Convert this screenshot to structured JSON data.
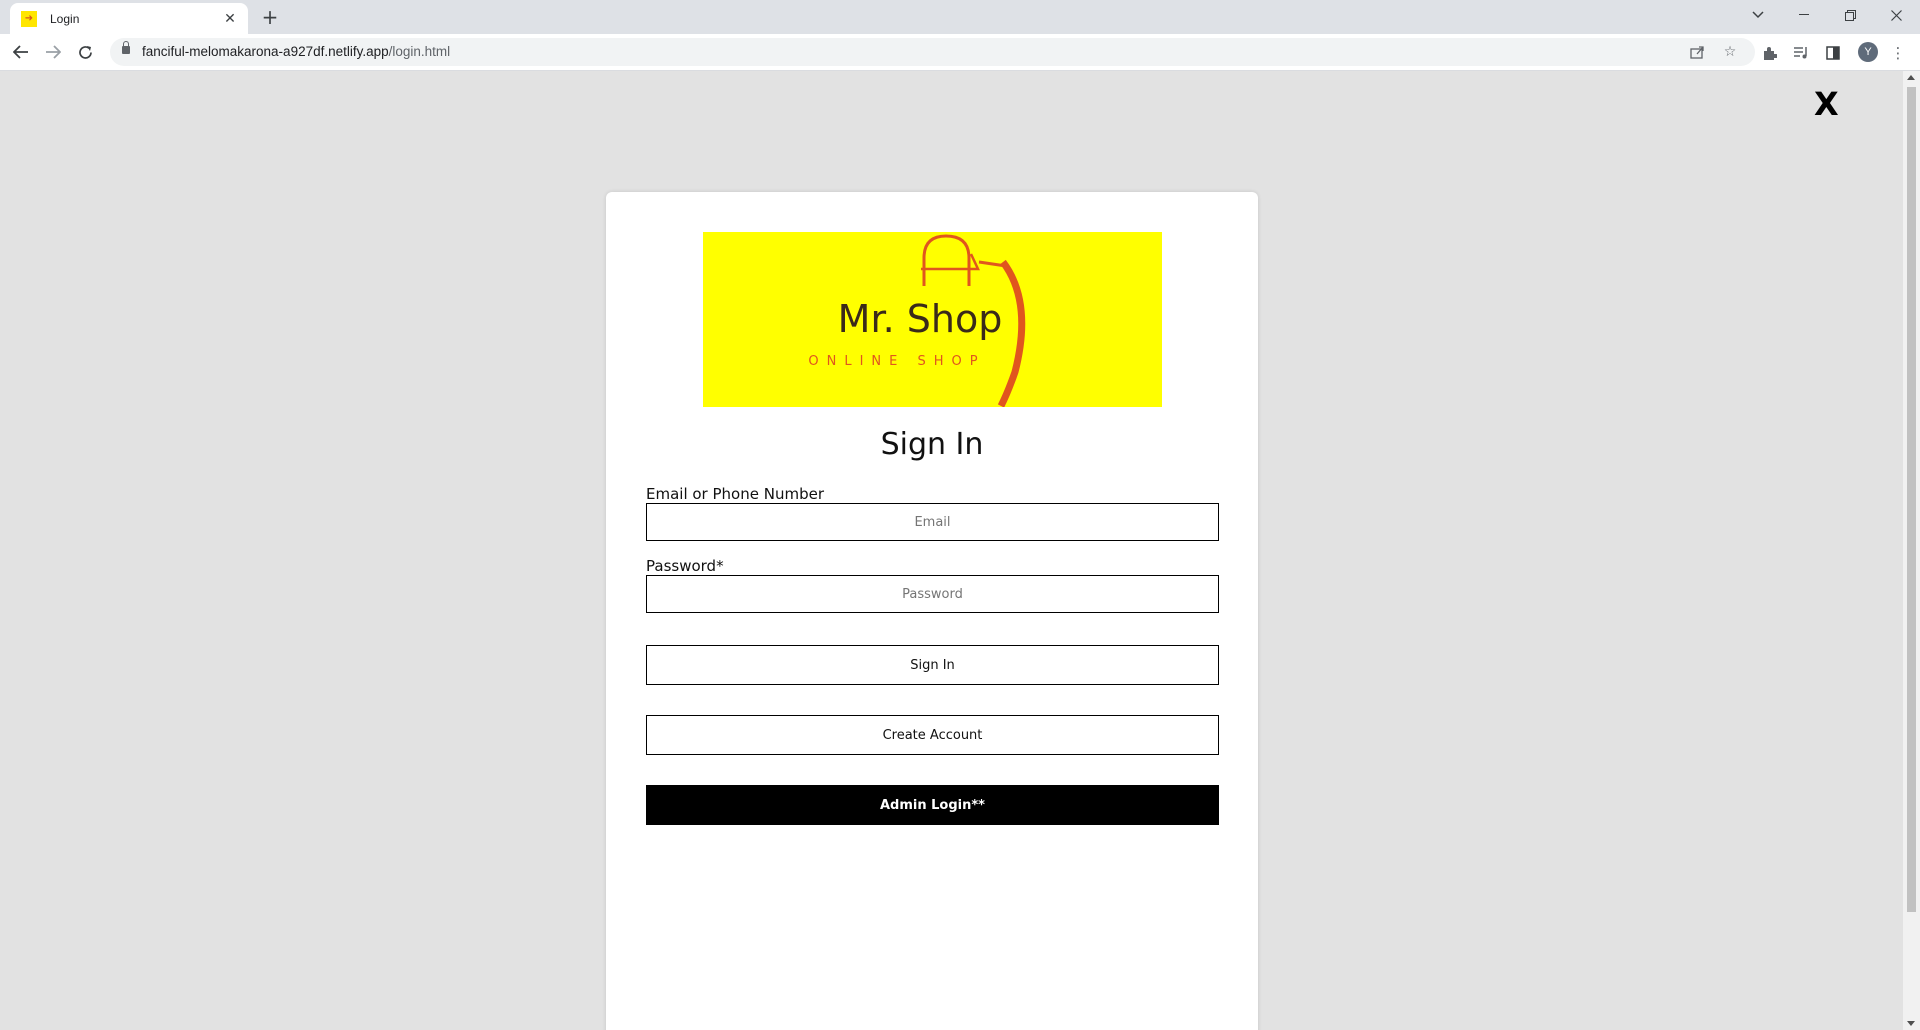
{
  "browser": {
    "tab_title": "Login",
    "url_host": "fanciful-melomakarona-a927df.netlify.app",
    "url_path": "/login.html",
    "profile_initial": "Y"
  },
  "page": {
    "close_label": "X",
    "logo": {
      "brand": "Mr. Shop",
      "tagline": "ONLINE SHOP",
      "background": "#ffff00",
      "accent": "#e0561e"
    },
    "title": "Sign In",
    "email_label": "Email or Phone Number",
    "email_placeholder": "Email",
    "password_label": "Password*",
    "password_placeholder": "Password",
    "signin_button": "Sign In",
    "create_account_button": "Create Account",
    "admin_login_button": "Admin Login**"
  }
}
